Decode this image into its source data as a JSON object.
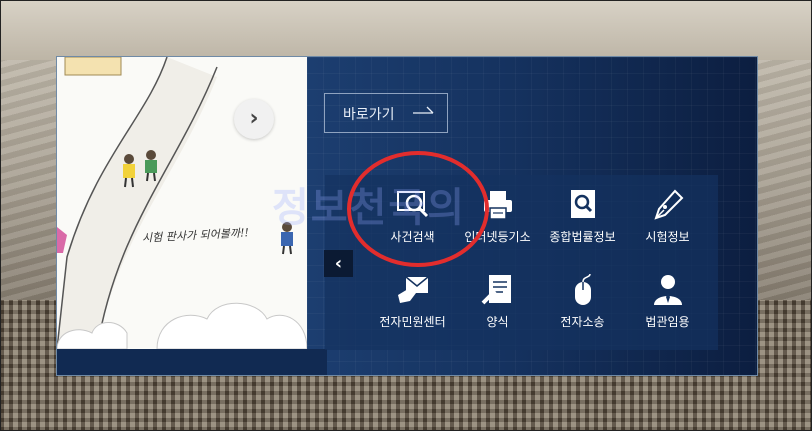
{
  "quick_link": {
    "label": "바로가기"
  },
  "illustration": {
    "caption": "시험 판사가 되어볼까!!"
  },
  "watermark": {
    "text": "정보천국의"
  },
  "menu": {
    "row1": [
      {
        "label": "사건검색",
        "icon": "magnifier-screen-icon"
      },
      {
        "label": "인터넷등기소",
        "icon": "printer-icon"
      },
      {
        "label": "종합법률정보",
        "icon": "law-book-search-icon"
      },
      {
        "label": "시험정보",
        "icon": "pen-nib-icon"
      }
    ],
    "row2": [
      {
        "label": "전자민원센터",
        "icon": "envelope-hand-icon"
      },
      {
        "label": "양식",
        "icon": "document-pen-icon"
      },
      {
        "label": "전자소송",
        "icon": "mouse-icon"
      },
      {
        "label": "법관임용",
        "icon": "person-tie-icon"
      }
    ]
  },
  "colors": {
    "highlight": "#e22d2d",
    "panel_dark": "#0e2244",
    "menu_bg": "#14325f"
  }
}
